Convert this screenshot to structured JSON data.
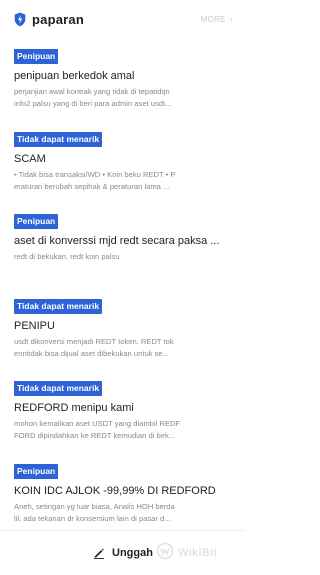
{
  "header": {
    "title": "paparan",
    "more_label": "MORE"
  },
  "items": [
    {
      "badge": "Penipuan",
      "title": "penipuan berkedok amal",
      "desc_lines": [
        "perjanjian awal kontrak yang tidak di tepatidqn",
        "info2 palsu yang di beri para admin aset usdt..."
      ]
    },
    {
      "badge": "Tidak dapat menarik",
      "title": "SCAM",
      "desc_lines": [
        "• Tidak bisa transaksi/WD • Koin beku REDT • P",
        "eraturan berubah sepihak & peraturan lama ..."
      ]
    },
    {
      "badge": "Penipuan",
      "title": "aset di konverssi mjd redt secara paksa ...",
      "desc_lines": [
        "redt di bekukan, redt koin palsu"
      ]
    },
    {
      "badge": "Tidak dapat menarik",
      "title": "PENIPU",
      "desc_lines": [
        "usdt dikonversi menjadi REDT token. REDT tok",
        "enntidak bisa dijual aset dibekukan untuk se..."
      ]
    },
    {
      "badge": "Tidak dapat menarik",
      "title": "REDFORD menipu kami",
      "desc_lines": [
        "mohon kemalikan aset USDT yang diambil REDF",
        "FORD dipindahkan ke REDT kemudian di bek..."
      ]
    },
    {
      "badge": "Penipuan",
      "title": "KOIN IDC AJLOK -99,99% DI REDFORD",
      "desc_lines": [
        "Aneh, setingan yg luar biasa, Analis HOH berda",
        "lil, ada tekanan dr konsersium lain di pasar d..."
      ]
    }
  ],
  "footer": {
    "upload_label": "Unggah",
    "watermark_text": "WikiBit"
  },
  "colors": {
    "badge": "#2e63d8",
    "title": "#222222",
    "desc": "#8a8a8a",
    "more": "#c9c9c9"
  },
  "icons": {
    "logo": "shield-icon",
    "upload": "pen-icon",
    "more": "chevron-right-icon"
  }
}
